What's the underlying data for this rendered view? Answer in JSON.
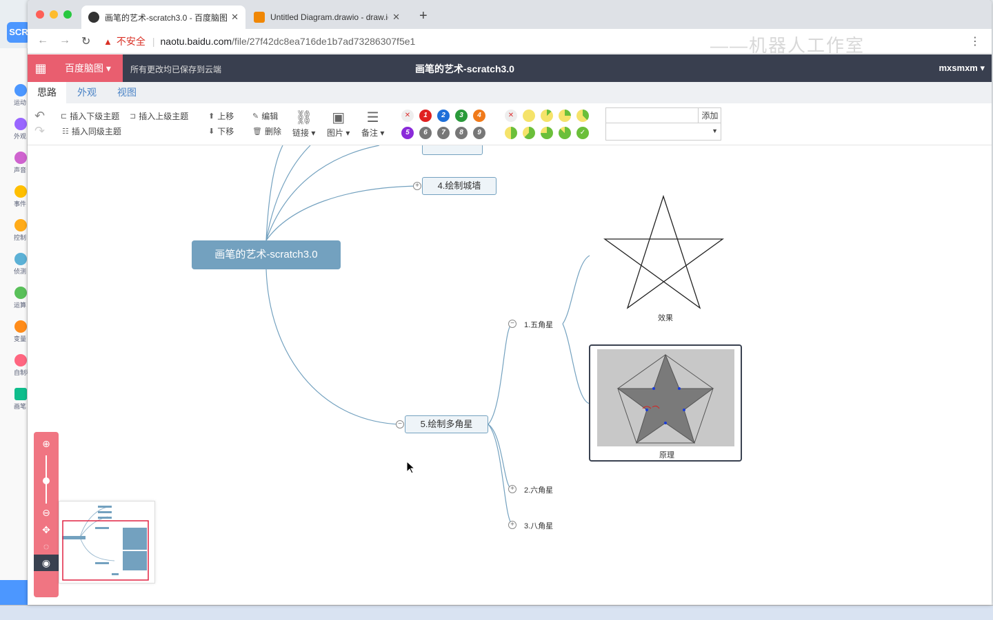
{
  "background_app": {
    "logo_text": "SCR",
    "categories": [
      "运动",
      "外观",
      "声音",
      "事件",
      "控制",
      "侦测",
      "运算",
      "变量",
      "自制积",
      "画笔"
    ],
    "category_colors": [
      "#4c97ff",
      "#9966ff",
      "#cf63cf",
      "#ffbf00",
      "#ffab19",
      "#5cb1d6",
      "#59c059",
      "#ff8c1a",
      "#ff6680",
      "#0fbd8c"
    ]
  },
  "browser": {
    "tabs": [
      {
        "title": "画笔的艺术-scratch3.0 - 百度脑图",
        "active": true
      },
      {
        "title": "Untitled Diagram.drawio - draw.io",
        "active": false
      }
    ],
    "new_tab": "+",
    "url_warning": "不安全",
    "url_host": "naotu.baidu.com",
    "url_path": "/file/27f42dc8ea716de1b7ad73286307f5e1",
    "watermark": "——机器人工作室"
  },
  "app": {
    "brand": "百度脑图",
    "save_status": "所有更改均已保存到云端",
    "document_title": "画笔的艺术-scratch3.0",
    "user": "mxsmxm",
    "menu_tabs": [
      "思路",
      "外观",
      "视图"
    ],
    "ribbon": {
      "insert_child": "插入下级主题",
      "insert_parent": "插入上级主题",
      "insert_sibling": "插入同级主题",
      "move_up": "上移",
      "move_down": "下移",
      "edit": "编辑",
      "delete": "删除",
      "link": "链接",
      "image": "图片",
      "note": "备注",
      "priorities": [
        "1",
        "2",
        "3",
        "4",
        "5",
        "6",
        "7",
        "8",
        "9"
      ],
      "resource_add": "添加"
    }
  },
  "mindmap": {
    "root": "画笔的艺术-scratch3.0",
    "topics": {
      "t4": "4.绘制城墙",
      "t5": "5.绘制多角星"
    },
    "subtopics": {
      "s1": "1.五角星",
      "s2": "2.六角星",
      "s3": "3.八角星"
    },
    "image_captions": {
      "effect": "效果",
      "principle": "原理"
    }
  }
}
